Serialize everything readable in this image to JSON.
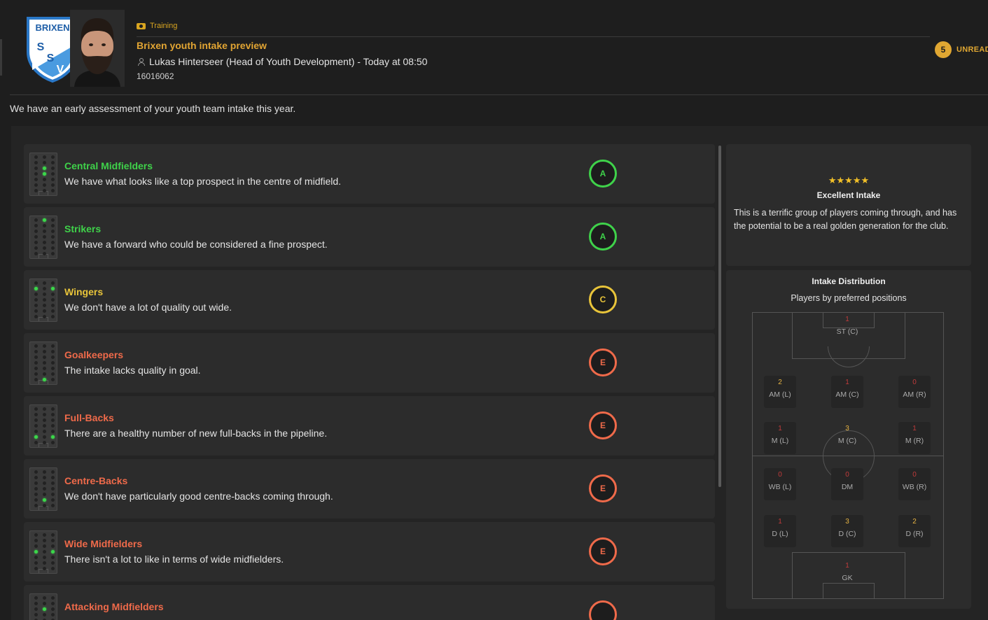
{
  "header": {
    "category": "Training",
    "title": "Brixen youth intake preview",
    "sender": "Lukas Hinterseer (Head of Youth Development) - Today at 08:50",
    "id": "16016062",
    "unread_count": "5",
    "unread_label": "UNREAD",
    "club_crest": {
      "top_text": "BRIXEN",
      "letters": [
        "S",
        "S",
        "V"
      ]
    }
  },
  "intro": "We have an early assessment of your youth team intake this year.",
  "assessments": [
    {
      "title": "Central Midfielders",
      "desc": "We have what looks like a top prospect in the centre of midfield.",
      "grade": "A",
      "color": "#3fd24a",
      "dots": [
        [
          1,
          2
        ],
        [
          1,
          3
        ]
      ]
    },
    {
      "title": "Strikers",
      "desc": "We have a forward who could be considered a fine prospect.",
      "grade": "A",
      "color": "#3fd24a",
      "dots": [
        [
          1,
          0
        ]
      ]
    },
    {
      "title": "Wingers",
      "desc": "We don't have a lot of quality out wide.",
      "grade": "C",
      "color": "#e8c43a",
      "dots": [
        [
          0,
          1
        ],
        [
          2,
          1
        ]
      ]
    },
    {
      "title": "Goalkeepers",
      "desc": "The intake lacks quality in goal.",
      "grade": "E",
      "color": "#ef6a4a",
      "dots": [
        [
          1,
          6
        ]
      ]
    },
    {
      "title": "Full-Backs",
      "desc": "There are a healthy number of new full-backs in the pipeline.",
      "grade": "E",
      "color": "#ef6a4a",
      "dots": [
        [
          0,
          5
        ],
        [
          2,
          5
        ]
      ]
    },
    {
      "title": "Centre-Backs",
      "desc": "We don't have particularly good centre-backs coming through.",
      "grade": "E",
      "color": "#ef6a4a",
      "dots": [
        [
          1,
          5
        ]
      ]
    },
    {
      "title": "Wide Midfielders",
      "desc": "There isn't a lot to like in terms of wide midfielders.",
      "grade": "E",
      "color": "#ef6a4a",
      "dots": [
        [
          0,
          3
        ],
        [
          2,
          3
        ]
      ]
    },
    {
      "title": "Attacking Midfielders",
      "desc": "",
      "grade": "",
      "color": "#ef6a4a",
      "dots": [
        [
          1,
          2
        ]
      ]
    }
  ],
  "summary": {
    "stars": "★★★★★",
    "star_rating": 5,
    "title": "Excellent Intake",
    "desc": "This is a terrific group of players coming through, and has the potential to be a real golden generation for the club."
  },
  "distribution": {
    "title": "Intake Distribution",
    "subtitle": "Players by preferred positions",
    "positions": [
      {
        "label": "ST (C)",
        "count": "1",
        "col": 1,
        "row": 0
      },
      {
        "label": "AM (L)",
        "count": "2",
        "col": 0,
        "row": 1
      },
      {
        "label": "AM (C)",
        "count": "1",
        "col": 1,
        "row": 1
      },
      {
        "label": "AM (R)",
        "count": "0",
        "col": 2,
        "row": 1
      },
      {
        "label": "M (L)",
        "count": "1",
        "col": 0,
        "row": 2
      },
      {
        "label": "M (C)",
        "count": "3",
        "col": 1,
        "row": 2
      },
      {
        "label": "M (R)",
        "count": "1",
        "col": 2,
        "row": 2
      },
      {
        "label": "WB (L)",
        "count": "0",
        "col": 0,
        "row": 3
      },
      {
        "label": "DM",
        "count": "0",
        "col": 1,
        "row": 3
      },
      {
        "label": "WB (R)",
        "count": "0",
        "col": 2,
        "row": 3
      },
      {
        "label": "D (L)",
        "count": "1",
        "col": 0,
        "row": 4
      },
      {
        "label": "D (C)",
        "count": "3",
        "col": 1,
        "row": 4
      },
      {
        "label": "D (R)",
        "count": "2",
        "col": 2,
        "row": 4
      },
      {
        "label": "GK",
        "count": "1",
        "col": 1,
        "row": 5
      }
    ]
  }
}
